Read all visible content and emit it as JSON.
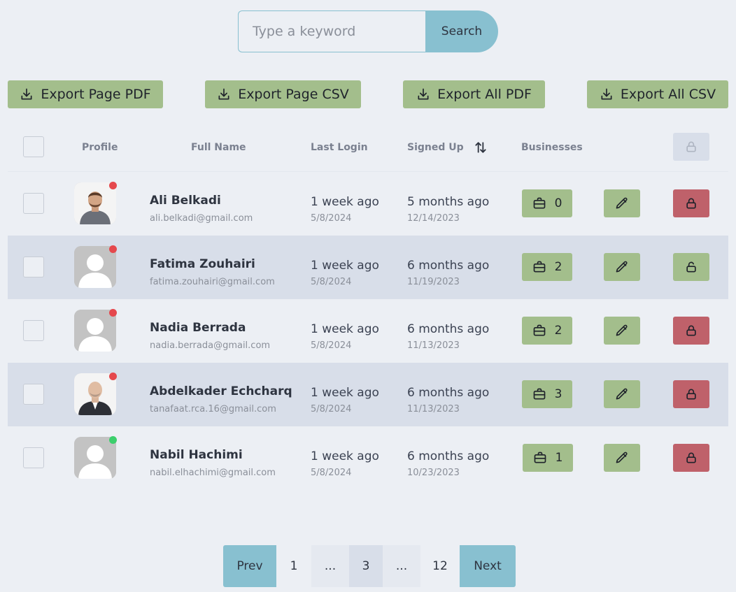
{
  "search": {
    "placeholder": "Type a keyword",
    "button_label": "Search"
  },
  "exports": [
    {
      "label": "Export Page PDF",
      "icon": "download-icon"
    },
    {
      "label": "Export Page CSV",
      "icon": "download-icon"
    },
    {
      "label": "Export All PDF",
      "icon": "download-icon"
    },
    {
      "label": "Export All CSV",
      "icon": "download-icon"
    }
  ],
  "table": {
    "headers": {
      "profile": "Profile",
      "full_name": "Full Name",
      "last_login": "Last Login",
      "signed_up": "Signed Up",
      "businesses": "Businesses"
    },
    "rows": [
      {
        "name": "Ali Belkadi",
        "email": "ali.belkadi@gmail.com",
        "last_login": "1 week ago",
        "last_login_date": "5/8/2024",
        "signed_up": "5 months ago",
        "signed_up_date": "12/14/2023",
        "businesses": "0",
        "status": "offline",
        "locked": true,
        "avatar": "photo"
      },
      {
        "name": "Fatima Zouhairi",
        "email": "fatima.zouhairi@gmail.com",
        "last_login": "1 week ago",
        "last_login_date": "5/8/2024",
        "signed_up": "6 months ago",
        "signed_up_date": "11/19/2023",
        "businesses": "2",
        "status": "offline",
        "locked": false,
        "avatar": "placeholder"
      },
      {
        "name": "Nadia Berrada",
        "email": "nadia.berrada@gmail.com",
        "last_login": "1 week ago",
        "last_login_date": "5/8/2024",
        "signed_up": "6 months ago",
        "signed_up_date": "11/13/2023",
        "businesses": "2",
        "status": "offline",
        "locked": true,
        "avatar": "placeholder"
      },
      {
        "name": "Abdelkader Echcharq",
        "email": "tanafaat.rca.16@gmail.com",
        "last_login": "1 week ago",
        "last_login_date": "5/8/2024",
        "signed_up": "6 months ago",
        "signed_up_date": "11/13/2023",
        "businesses": "3",
        "status": "offline",
        "locked": true,
        "avatar": "photo"
      },
      {
        "name": "Nabil Hachimi",
        "email": "nabil.elhachimi@gmail.com",
        "last_login": "1 week ago",
        "last_login_date": "5/8/2024",
        "signed_up": "6 months ago",
        "signed_up_date": "10/23/2023",
        "businesses": "1",
        "status": "online",
        "locked": true,
        "avatar": "placeholder"
      }
    ]
  },
  "pagination": {
    "prev": "Prev",
    "first": "1",
    "gap_left": "...",
    "current": "3",
    "gap_right": "...",
    "last": "12",
    "next": "Next"
  },
  "colors": {
    "background": "#eceff4",
    "accent": "#88c0d0",
    "green": "#a3be8c",
    "red": "#bf616a",
    "status_offline": "#e5484d",
    "status_online": "#3ccf6c"
  }
}
